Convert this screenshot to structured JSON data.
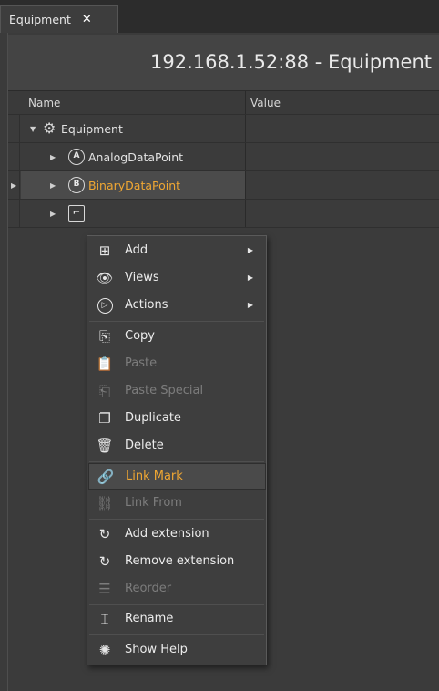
{
  "tab": {
    "label": "Equipment",
    "close_icon": "close-icon"
  },
  "header": {
    "title": "192.168.1.52:88 - Equipment"
  },
  "columns": {
    "name": "Name",
    "value": "Value"
  },
  "tree": [
    {
      "label": "Equipment",
      "icon": "gear-icon",
      "expanded": true,
      "selected": false
    },
    {
      "label": "AnalogDataPoint",
      "icon": "analog-point-icon",
      "icon_glyph": "A",
      "selected": false
    },
    {
      "label": "BinaryDataPoint",
      "icon": "binary-point-icon",
      "icon_glyph": "B",
      "selected": true,
      "color": "#f0a733"
    },
    {
      "label": "",
      "icon": "chart-point-icon",
      "selected": false
    }
  ],
  "context_menu": {
    "items": [
      {
        "label": "Add",
        "icon": "add-icon",
        "submenu": true,
        "enabled": true
      },
      {
        "label": "Views",
        "icon": "eye-icon",
        "submenu": true,
        "enabled": true
      },
      {
        "label": "Actions",
        "icon": "play-circle-icon",
        "submenu": true,
        "enabled": true
      },
      {
        "label": "Copy",
        "icon": "copy-icon",
        "enabled": true
      },
      {
        "label": "Paste",
        "icon": "paste-icon",
        "enabled": false
      },
      {
        "label": "Paste Special",
        "icon": "paste-special-icon",
        "enabled": false
      },
      {
        "label": "Duplicate",
        "icon": "duplicate-icon",
        "enabled": true
      },
      {
        "label": "Delete",
        "icon": "trash-icon",
        "enabled": true
      },
      {
        "label": "Link Mark",
        "icon": "link-icon",
        "enabled": true,
        "highlighted": true
      },
      {
        "label": "Link From",
        "icon": "link-from-icon",
        "enabled": false
      },
      {
        "label": "Add extension",
        "icon": "extension-add-icon",
        "enabled": true
      },
      {
        "label": "Remove extension",
        "icon": "extension-remove-icon",
        "enabled": true
      },
      {
        "label": "Reorder",
        "icon": "reorder-icon",
        "enabled": false
      },
      {
        "label": "Rename",
        "icon": "rename-icon",
        "enabled": true
      },
      {
        "label": "Show Help",
        "icon": "help-bulb-icon",
        "enabled": true
      }
    ]
  },
  "colors": {
    "accent": "#f0a733",
    "background": "#3b3b3b",
    "menu_bg": "#3e3e3e"
  }
}
